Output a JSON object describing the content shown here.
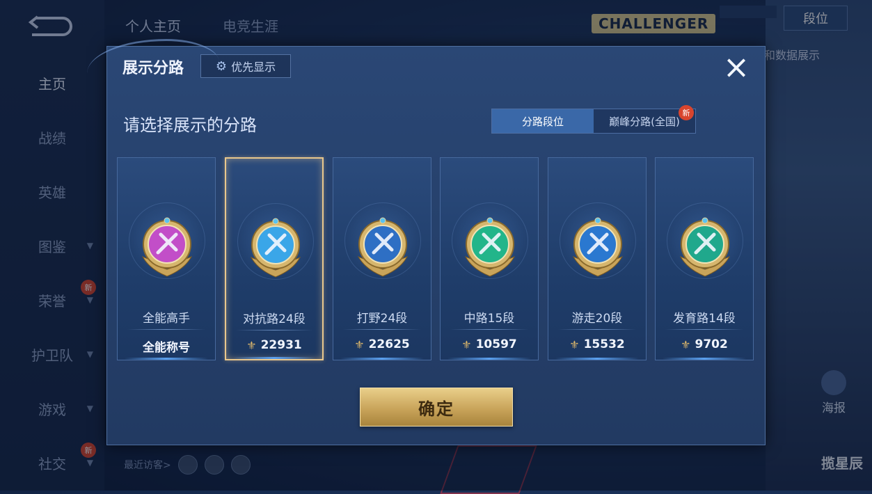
{
  "background": {
    "nav": [
      {
        "label": "主页",
        "active": true,
        "chevron": false,
        "new": false
      },
      {
        "label": "战绩",
        "active": false,
        "chevron": false,
        "new": false
      },
      {
        "label": "英雄",
        "active": false,
        "chevron": false,
        "new": false
      },
      {
        "label": "图鉴",
        "active": false,
        "chevron": true,
        "new": false
      },
      {
        "label": "荣誉",
        "active": false,
        "chevron": true,
        "new": true
      },
      {
        "label": "护卫队",
        "active": false,
        "chevron": true,
        "new": false
      },
      {
        "label": "游戏",
        "active": false,
        "chevron": true,
        "new": false
      },
      {
        "label": "社交",
        "active": false,
        "chevron": true,
        "new": true
      }
    ],
    "new_badge": "新",
    "top_tabs": [
      "个人主页",
      "电竞生涯"
    ],
    "challenger_text": "CHALLENGER",
    "rank_button": "段位",
    "data_show": "和数据展示",
    "poster_label": "海报",
    "recent_visitors": "最近访客>",
    "bottom_right_label": "揽星辰"
  },
  "modal": {
    "title": "展示分路",
    "priority_button": "优先显示",
    "close_icon": "×",
    "section_title": "请选择展示的分路",
    "toggle": {
      "options": [
        "分路段位",
        "巅峰分路(全国)"
      ],
      "selected_index": 0,
      "new_badge": "新"
    },
    "cards": [
      {
        "name": "全能高手",
        "score": "全能称号",
        "has_icon": false,
        "emblem": "purple-swirl-icon",
        "color": "#c24ec8",
        "selected": false
      },
      {
        "name": "对抗路24段",
        "score": "22931",
        "has_icon": true,
        "emblem": "sword-shield-icon",
        "color": "#3aa6e8",
        "selected": true
      },
      {
        "name": "打野24段",
        "score": "22625",
        "has_icon": true,
        "emblem": "dragon-icon",
        "color": "#2e6fc4",
        "selected": false
      },
      {
        "name": "中路15段",
        "score": "10597",
        "has_icon": true,
        "emblem": "wand-icon",
        "color": "#22b58a",
        "selected": false
      },
      {
        "name": "游走20段",
        "score": "15532",
        "has_icon": true,
        "emblem": "wings-icon",
        "color": "#2a78d0",
        "selected": false
      },
      {
        "name": "发育路14段",
        "score": "9702",
        "has_icon": true,
        "emblem": "s-arrow-icon",
        "color": "#20a88c",
        "selected": false
      }
    ],
    "score_icon": "⚜",
    "confirm_button": "确定"
  }
}
